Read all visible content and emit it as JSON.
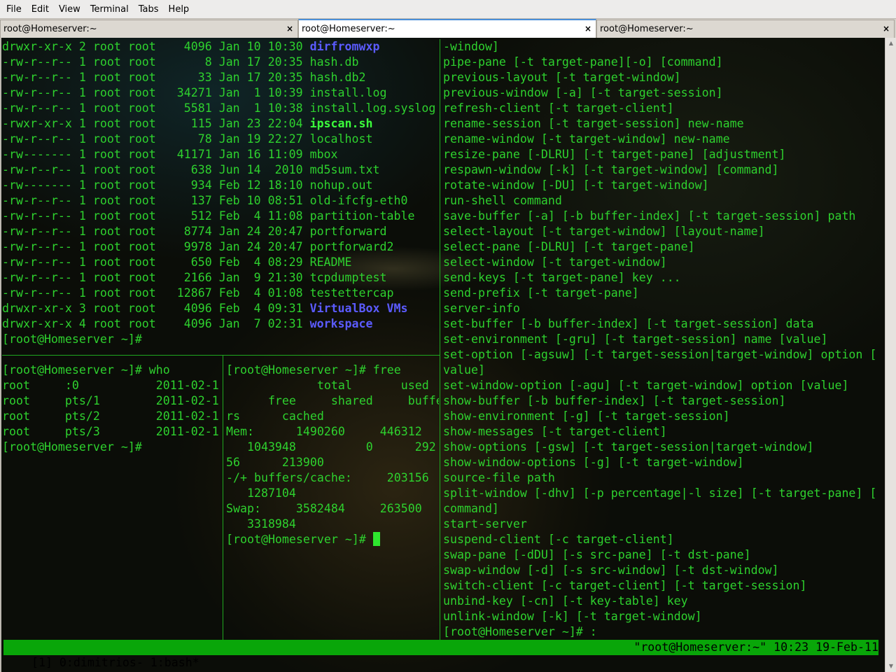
{
  "menu": [
    "File",
    "Edit",
    "View",
    "Terminal",
    "Tabs",
    "Help"
  ],
  "tabs": [
    {
      "title": "root@Homeserver:~",
      "active": false
    },
    {
      "title": "root@Homeserver:~",
      "active": true
    },
    {
      "title": "root@Homeserver:~",
      "active": false
    }
  ],
  "tab_close": "×",
  "pane_ls": [
    {
      "meta": "drwxr-xr-x 2 root root    4096 Jan 10 10:30 ",
      "name": "dirfromwxp",
      "type": "dir"
    },
    {
      "meta": "-rw-r--r-- 1 root root       8 Jan 17 20:35 ",
      "name": "hash.db",
      "type": "file"
    },
    {
      "meta": "-rw-r--r-- 1 root root      33 Jan 17 20:35 ",
      "name": "hash.db2",
      "type": "file"
    },
    {
      "meta": "-rw-r--r-- 1 root root   34271 Jan  1 10:39 ",
      "name": "install.log",
      "type": "file"
    },
    {
      "meta": "-rw-r--r-- 1 root root    5581 Jan  1 10:38 ",
      "name": "install.log.syslog",
      "type": "file"
    },
    {
      "meta": "-rwxr-xr-x 1 root root     115 Jan 23 22:04 ",
      "name": "ipscan.sh",
      "type": "exe"
    },
    {
      "meta": "-rw-r--r-- 1 root root      78 Jan 19 22:27 ",
      "name": "localhost",
      "type": "file"
    },
    {
      "meta": "-rw------- 1 root root   41171 Jan 16 11:09 ",
      "name": "mbox",
      "type": "file"
    },
    {
      "meta": "-rw-r--r-- 1 root root     638 Jun 14  2010 ",
      "name": "md5sum.txt",
      "type": "file"
    },
    {
      "meta": "-rw------- 1 root root     934 Feb 12 18:10 ",
      "name": "nohup.out",
      "type": "file"
    },
    {
      "meta": "-rw-r--r-- 1 root root     137 Feb 10 08:51 ",
      "name": "old-ifcfg-eth0",
      "type": "file"
    },
    {
      "meta": "-rw-r--r-- 1 root root     512 Feb  4 11:08 ",
      "name": "partition-table",
      "type": "file"
    },
    {
      "meta": "-rw-r--r-- 1 root root    8774 Jan 24 20:47 ",
      "name": "portforward",
      "type": "file"
    },
    {
      "meta": "-rw-r--r-- 1 root root    9978 Jan 24 20:47 ",
      "name": "portforward2",
      "type": "file"
    },
    {
      "meta": "-rw-r--r-- 1 root root     650 Feb  4 08:29 ",
      "name": "README",
      "type": "file"
    },
    {
      "meta": "-rw-r--r-- 1 root root    2166 Jan  9 21:30 ",
      "name": "tcpdumptest",
      "type": "file"
    },
    {
      "meta": "-rw-r--r-- 1 root root   12867 Feb  4 01:08 ",
      "name": "testettercap",
      "type": "file"
    },
    {
      "meta": "drwxr-xr-x 3 root root    4096 Feb  4 09:31 ",
      "name": "VirtualBox VMs",
      "type": "dir"
    },
    {
      "meta": "drwxr-xr-x 4 root root    4096 Jan  7 02:31 ",
      "name": "workspace",
      "type": "dir"
    },
    {
      "meta": "[root@Homeserver ~]#",
      "name": "",
      "type": "file"
    }
  ],
  "pane_who": [
    "[root@Homeserver ~]# who",
    "root     :0           2011-02-1",
    "root     pts/1        2011-02-1",
    "root     pts/2        2011-02-1",
    "root     pts/3        2011-02-1",
    "[root@Homeserver ~]#"
  ],
  "pane_free": [
    "[root@Homeserver ~]# free",
    "             total       used",
    "      free     shared     buffe",
    "rs      cached",
    "Mem:      1490260     446312",
    "   1043948          0      292",
    "56      213900",
    "-/+ buffers/cache:     203156",
    "   1287104",
    "Swap:     3582484     263500",
    "   3318984",
    "[root@Homeserver ~]# "
  ],
  "pane_tmux": [
    "-window]",
    "pipe-pane [-t target-pane][-o] [command]",
    "previous-layout [-t target-window]",
    "previous-window [-a] [-t target-session]",
    "refresh-client [-t target-client]",
    "rename-session [-t target-session] new-name",
    "rename-window [-t target-window] new-name",
    "resize-pane [-DLRU] [-t target-pane] [adjustment]",
    "respawn-window [-k] [-t target-window] [command]",
    "rotate-window [-DU] [-t target-window]",
    "run-shell command",
    "save-buffer [-a] [-b buffer-index] [-t target-session] path",
    "select-layout [-t target-window] [layout-name]",
    "select-pane [-DLRU] [-t target-pane]",
    "select-window [-t target-window]",
    "send-keys [-t target-pane] key ...",
    "send-prefix [-t target-pane]",
    "server-info",
    "set-buffer [-b buffer-index] [-t target-session] data",
    "set-environment [-gru] [-t target-session] name [value]",
    "set-option [-agsuw] [-t target-session|target-window] option [",
    "value]",
    "set-window-option [-agu] [-t target-window] option [value]",
    "show-buffer [-b buffer-index] [-t target-session]",
    "show-environment [-g] [-t target-session]",
    "show-messages [-t target-client]",
    "show-options [-gsw] [-t target-session|target-window]",
    "show-window-options [-g] [-t target-window]",
    "source-file path",
    "split-window [-dhv] [-p percentage|-l size] [-t target-pane] [",
    "command]",
    "start-server",
    "suspend-client [-c target-client]",
    "swap-pane [-dDU] [-s src-pane] [-t dst-pane]",
    "swap-window [-d] [-s src-window] [-t dst-window]",
    "switch-client [-c target-client] [-t target-session]",
    "unbind-key [-cn] [-t key-table] key",
    "unlink-window [-k] [-t target-window]",
    "[root@Homeserver ~]# :"
  ],
  "status": {
    "left": "[1] 0:dimitrios- 1:bash*",
    "right": "\"root@Homeserver:~\" 10:23 19-Feb-11"
  },
  "colors": {
    "fg": "#2ed12e",
    "dir": "#5b5bff",
    "status_bg": "#09a609"
  }
}
